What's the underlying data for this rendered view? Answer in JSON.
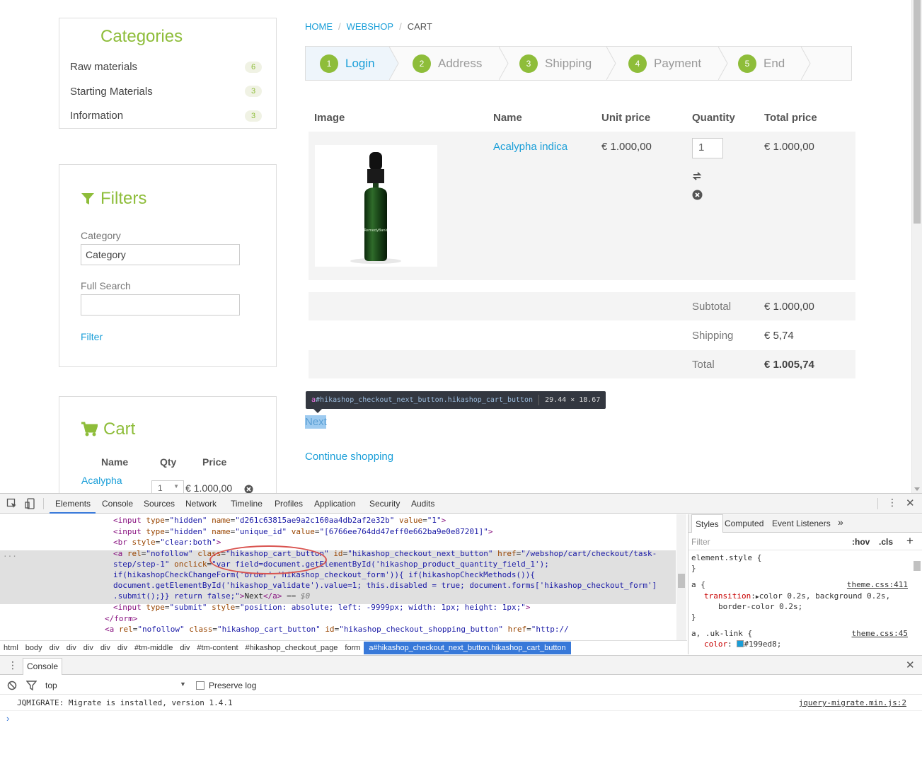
{
  "sidebar": {
    "categories": {
      "title": "Categories",
      "items": [
        {
          "label": "Raw materials",
          "count": "6"
        },
        {
          "label": "Starting Materials",
          "count": "3"
        },
        {
          "label": "Information",
          "count": "3"
        }
      ]
    },
    "filters": {
      "title": "Filters",
      "category_label": "Category",
      "category_value": "Category",
      "search_label": "Full Search",
      "search_value": "",
      "filter_link": "Filter"
    },
    "cart": {
      "title": "Cart",
      "col_name": "Name",
      "col_qty": "Qty",
      "col_price": "Price",
      "item_name": "Acalypha",
      "item_qty": "1",
      "item_price": "€ 1.000,00"
    }
  },
  "breadcrumb": {
    "home": "HOME",
    "webshop": "WEBSHOP",
    "current": "CART",
    "sep": "/"
  },
  "steps": [
    {
      "num": "1",
      "label": "Login"
    },
    {
      "num": "2",
      "label": "Address"
    },
    {
      "num": "3",
      "label": "Shipping"
    },
    {
      "num": "4",
      "label": "Payment"
    },
    {
      "num": "5",
      "label": "End"
    }
  ],
  "table": {
    "headers": {
      "image": "Image",
      "name": "Name",
      "unit_price": "Unit price",
      "quantity": "Quantity",
      "total_price": "Total price"
    },
    "row": {
      "product_name": "Acalypha indica",
      "product_image_text": "RemedyBank",
      "unit_price": "€ 1.000,00",
      "quantity": "1",
      "total_price": "€ 1.000,00"
    },
    "summary": {
      "subtotal_label": "Subtotal",
      "subtotal_value": "€ 1.000,00",
      "shipping_label": "Shipping",
      "shipping_value": "€ 5,74",
      "total_label": "Total",
      "total_value": "€ 1.005,74"
    }
  },
  "inspector_tooltip": {
    "tag": "a",
    "selector": "#hikashop_checkout_next_button.hikashop_cart_button",
    "dims": "29.44 × 18.67"
  },
  "next_label": "Next",
  "continue_label": "Continue shopping",
  "devtools": {
    "tabs": [
      "Elements",
      "Console",
      "Sources",
      "Network",
      "Timeline",
      "Profiles",
      "Application",
      "Security",
      "Audits"
    ],
    "code_lines": {
      "l1_name": "d261c63815ae9a2c160aa4db2af2e32b",
      "l1_value": "1",
      "l2_name": "unique_id",
      "l2_value": "[6766ee764dd47eff0e662ba9e0e87201]",
      "l3_style": "clear:both",
      "sel_rel": "nofollow",
      "sel_class": "hikashop_cart_button",
      "sel_id": "hikashop_checkout_next_button",
      "sel_href": "/webshop/cart/checkout/task-",
      "sel_href2": "step/step-1",
      "sel_onclick1": "var field=document.getElementById('hikashop_product_quantity_field_1');",
      "sel_onclick2": "if(hikashopCheckChangeForm('order','hikashop_checkout_form')){ if(hikashopCheckMethods()){",
      "sel_onclick3": "document.getElementById('hikashop_validate').value=1; this.disabled = true; document.forms['hikashop_checkout_form']",
      "sel_onclick4": ".submit();}} return false;",
      "sel_text": "Next",
      "sel_suffix": "== $0",
      "l_submit_style": "position: absolute; left: -9999px; width: 1px; height: 1px;",
      "l_next_class": "hikashop_cart_button",
      "l_next_id": "hikashop_checkout_shopping_button",
      "l_next_href": "http://"
    },
    "crumbs": [
      "html",
      "body",
      "div",
      "div",
      "div",
      "div",
      "div",
      "#tm-middle",
      "div",
      "#tm-content",
      "#hikashop_checkout_page",
      "form",
      "a#hikashop_checkout_next_button.hikashop_cart_button"
    ],
    "styles_tabs": [
      "Styles",
      "Computed",
      "Event Listeners"
    ],
    "styles_filter": "Filter",
    "styles_hov": ":hov",
    "styles_cls": ".cls",
    "rules": {
      "r1": "element.style {",
      "r1_close": "}",
      "r2_sel": "a {",
      "r2_src": "theme.css:411",
      "r2_prop": "transition",
      "r2_val": "color 0.2s, background 0.2s,",
      "r2_val2": "border-color 0.2s;",
      "r2_close": "}",
      "r3_sel": "a, .uk-link {",
      "r3_src": "theme.css:45",
      "r3_prop": "color",
      "r3_val": "#199ed8;",
      "r3_color": "#199ed8"
    },
    "console": {
      "title": "Console",
      "context": "top",
      "preserve_log": "Preserve log",
      "message": "JQMIGRATE: Migrate is installed, version 1.4.1",
      "source": "jquery-migrate.min.js:2"
    }
  },
  "colors": {
    "accent_green": "#8ebd3a",
    "link_blue": "#199ed8",
    "devtools_blue": "#3879d9"
  }
}
